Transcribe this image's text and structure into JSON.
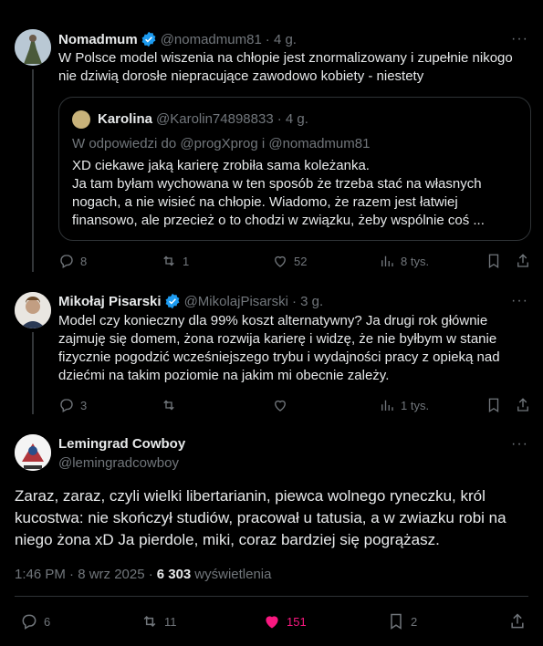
{
  "post1": {
    "name": "Nomadmum",
    "handle": "@nomadmum81",
    "time": "· 4 g.",
    "text": "W Polsce model wiszenia na chłopie jest znormalizowany i zupełnie nikogo nie dziwią dorosłe  niepracujące zawodowo  kobiety - niestety",
    "quote": {
      "name": "Karolina",
      "handle": "@Karolin74898833",
      "time": "· 4 g.",
      "reply_to": "W odpowiedzi do @progXprog i @nomadmum81",
      "text": "XD ciekawe jaką karierę zrobiła sama koleżanka.\nJa tam byłam wychowana w ten sposób że trzeba stać na własnych nogach, a nie wisieć na chłopie. Wiadomo, że razem jest łatwiej finansowo, ale przecież o to chodzi w związku, żeby wspólnie coś ..."
    },
    "replies": "8",
    "reposts": "1",
    "likes": "52",
    "views": "8 tys."
  },
  "post2": {
    "name": "Mikołaj Pisarski",
    "handle": "@MikolajPisarski",
    "time": "· 3 g.",
    "text": "Model czy konieczny dla 99% koszt alternatywny? Ja drugi rok głównie zajmuję się domem, żona rozwija karierę i widzę, że nie byłbym w stanie fizycznie pogodzić wcześniejszego trybu i wydajności pracy z opieką nad dziećmi na takim poziomie na jakim mi obecnie zależy.",
    "replies": "3",
    "reposts": "",
    "likes": "",
    "views": "1 tys."
  },
  "main": {
    "name": "Lemingrad Cowboy",
    "handle": "@lemingradcowboy",
    "text": "Zaraz, zaraz, czyli wielki libertarianin, piewca wolnego ryneczku, król kucostwa: nie skończył studiów, pracował u tatusia, a w zwiazku robi na niego żona xD Ja pierdole, miki, coraz bardziej się pogrążasz.",
    "time": "1:46 PM · 8 wrz 2025 ·",
    "views_count": "6 303",
    "views_label": "wyświetlenia",
    "replies": "6",
    "reposts": "11",
    "likes": "151",
    "bookmarks": "2"
  },
  "colors": {
    "verified": "#1d9bf0",
    "like_active": "#f91880",
    "muted": "#71767b"
  },
  "dots": "···"
}
